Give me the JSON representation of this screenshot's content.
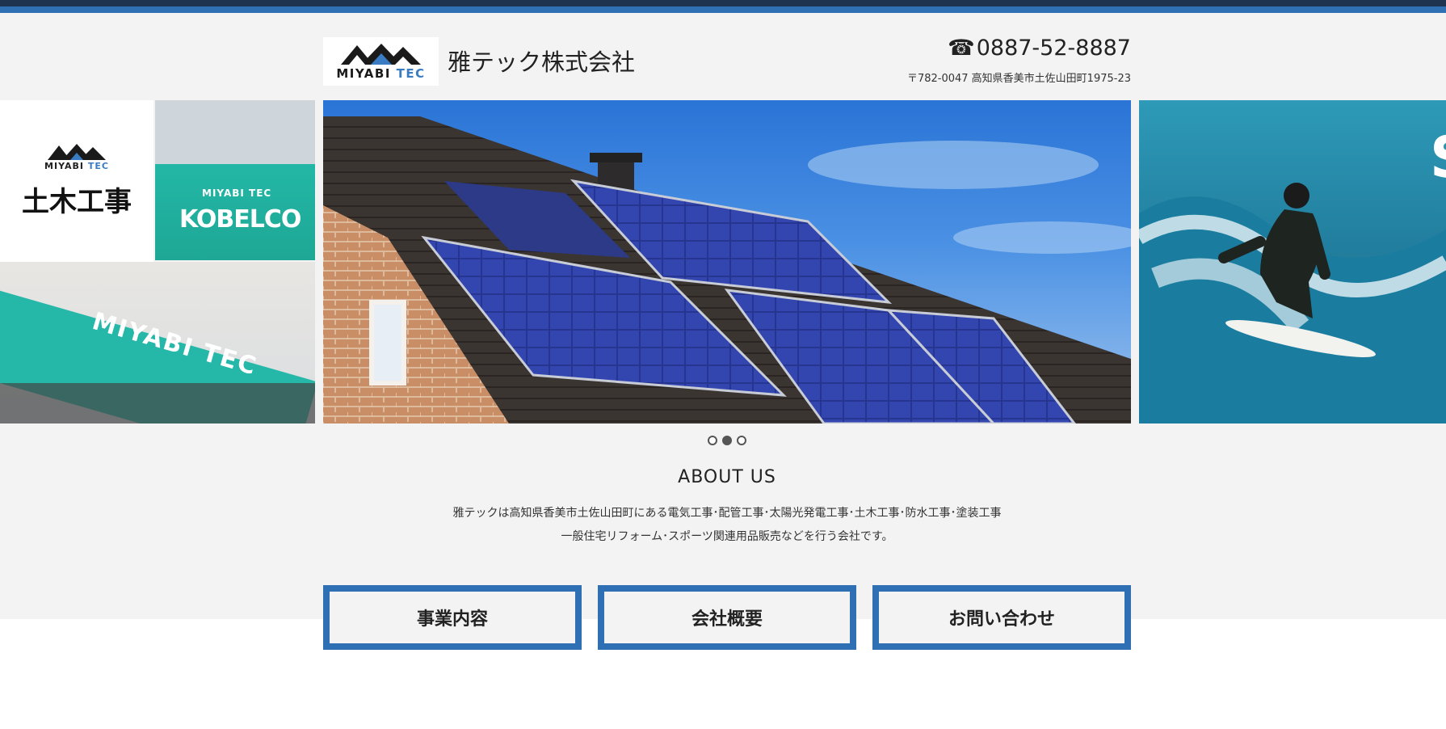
{
  "header": {
    "logo_main": "MIYABI",
    "logo_accent": "TEC",
    "company_name": "雅テック株式会社",
    "phone_icon": "telephone-icon",
    "phone": "0887-52-8887",
    "address": "〒782-0047  高知県香美市土佐山田町1975-23"
  },
  "slider": {
    "left": {
      "card_logo_main": "MIYABI",
      "card_logo_accent": "TEC",
      "card_label": "土木工事",
      "machine_logo": "MIYABI TEC",
      "machine_brand": "KOBELCO",
      "arm_text": "MIYABI TEC"
    },
    "right": {
      "title_initial": "S"
    },
    "dots_total": 3,
    "dots_active_index": 2
  },
  "about": {
    "title": "ABOUT US",
    "line1": "雅テックは高知県香美市土佐山田町にある電気工事･配管工事･太陽光発電工事･土木工事･防水工事･塗装工事",
    "line2": "一般住宅リフォーム･スポーツ関連用品販売などを行う会社です。"
  },
  "nav": {
    "business": "事業内容",
    "company": "会社概要",
    "contact": "お問い合わせ"
  },
  "colors": {
    "accent": "#2f6fb3",
    "topbar": "#1e3350",
    "background": "#f3f3f3"
  }
}
